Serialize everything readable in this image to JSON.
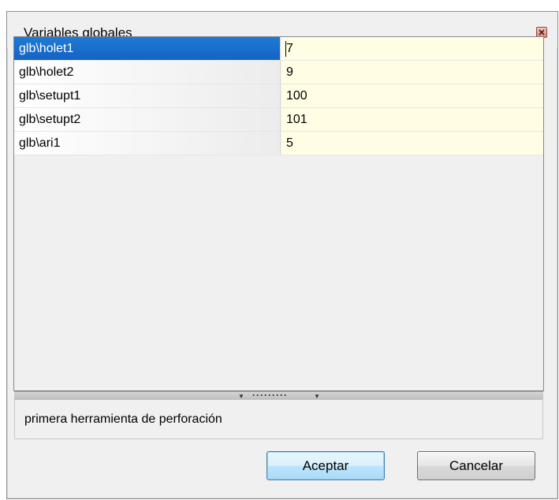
{
  "dialog": {
    "title": "Variables globales"
  },
  "grid": {
    "rows": [
      {
        "name": "glb\\holet1",
        "value": "7"
      },
      {
        "name": "glb\\holet2",
        "value": "9"
      },
      {
        "name": "glb\\setupt1",
        "value": "100"
      },
      {
        "name": "glb\\setupt2",
        "value": "101"
      },
      {
        "name": "glb\\ari1",
        "value": "5"
      }
    ],
    "selected_row": 0
  },
  "description": {
    "text": "primera herramienta de perforación"
  },
  "buttons": {
    "accept_label": "Aceptar",
    "cancel_label": "Cancelar"
  },
  "icons": {
    "close": "close-icon",
    "splitter_left": "triangle-down-icon",
    "splitter_right": "triangle-down-icon"
  },
  "colors": {
    "selection": "#1e7ad6",
    "value_background": "#fffde3",
    "dialog_background": "#f0f0f0",
    "default_button": "#bee6fd"
  }
}
